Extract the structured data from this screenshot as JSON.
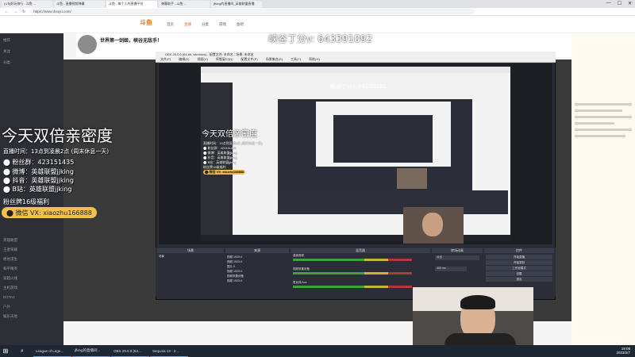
{
  "browser": {
    "tabs": [
      {
        "label": "(1/5)好玩排行 - 斗鱼 ...",
        "active": false
      },
      {
        "label": "斗鱼 - 直播视频弹幕",
        "active": false
      },
      {
        "label": "斗鱼 - 每个人的直播平台",
        "active": true
      },
      {
        "label": "弹幕助手 - 斗鱼 ...",
        "active": false
      },
      {
        "label": "jfking的直播间_英雄联盟直播",
        "active": false
      }
    ],
    "url": "https://www.douyu.com/"
  },
  "douyu": {
    "logo": "斗鱼",
    "nav": [
      "首页",
      "直播",
      "分类",
      "游戏",
      "鱼吧"
    ],
    "room_title": "世界第一剑姬，峡谷无敌手！",
    "sidebar_items": [
      "推荐",
      "关注",
      "分类",
      "英雄联盟",
      "王者荣耀",
      "绝地求生",
      "和平精英",
      "穿越火线",
      "主机游戏",
      "DOTA2",
      "户外",
      "娱乐天地"
    ]
  },
  "overlay": {
    "watermark": "峡谷丁分v: 643391092",
    "inner_watermark": "峡谷丁分v: 643391092",
    "promo_title": "今天双倍亲密度",
    "promo_lines": [
      "直播时间：13点到凌晨2点 (周末休息一天)",
      "⬤ 粉丝群：423151435",
      "⬤ 微博：英雄联盟jjking",
      "⬤ 抖音：英雄联盟jjking",
      "⬤ B站：英雄联盟jjking",
      "粉丝牌16级福利"
    ],
    "promo_wechat": "⬤ 微信 VX: xiaozhu166888",
    "inner_promo_title": "今天双倍亲密度"
  },
  "obs": {
    "title": "OBS 29.0.0 (64-bit, windows) - 配置文件: 未命名 - 场景: 未命名",
    "menu": [
      "文件(F)",
      "编辑(E)",
      "视图(V)",
      "停靠窗口(D)",
      "配置文件(P)",
      "场景集合(S)",
      "工具(T)",
      "帮助(H)"
    ],
    "docks": [
      "场景",
      "来源",
      "混音器",
      "转场动画",
      "控件"
    ],
    "scene": "场景",
    "sources": [
      "视频 1920×1",
      "视频 1920×1",
      "图片 5",
      "视频 1920×1",
      "视频采集设备",
      "视频 1920×1"
    ],
    "mixer": [
      "桌面音频",
      "视频采集设备",
      "麦克风/Aux"
    ],
    "controls": [
      "开始直播",
      "开始录制",
      "工作室模式",
      "设置",
      "退出"
    ],
    "transition": "淡出",
    "duration": "300 ms"
  },
  "taskbar": {
    "items": [
      "League of Lege...",
      "jfking的直播间...",
      "OBS 29.0.0 (64...",
      "Sequoia 13 - 2..."
    ],
    "time": "19:08",
    "date": "2023/2/7"
  }
}
